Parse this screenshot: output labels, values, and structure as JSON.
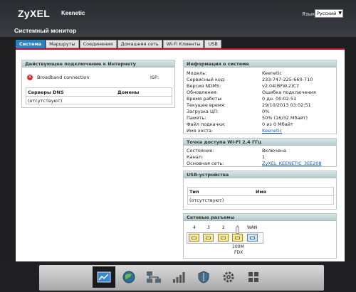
{
  "header": {
    "brand": "ZyXEL",
    "model": "Keenetic",
    "page_title": "Системный монитор",
    "language_label": "Язык:",
    "language_value": "Русский"
  },
  "tabs": [
    {
      "label": "Система",
      "active": true
    },
    {
      "label": "Маршруты"
    },
    {
      "label": "Соединения"
    },
    {
      "label": "Домашняя сеть"
    },
    {
      "label": "Wi-Fi Клиенты"
    },
    {
      "label": "USB"
    }
  ],
  "internet": {
    "title": "Действующее подключение к Интернету",
    "connection_name": "Broadband connection",
    "isp_label": "ISP:",
    "dns_header": "Серверы DNS",
    "domains_header": "Домены",
    "dns_value": "(отсутствуют)"
  },
  "sysinfo": {
    "title": "Информация о системе",
    "rows": [
      {
        "label": "Модель:",
        "value": "Keenetic"
      },
      {
        "label": "Сервисный код:",
        "value": "233-747-225-660-710"
      },
      {
        "label": "Версия NDMS:",
        "value": "v2.04(BFW.2)C7"
      },
      {
        "label": "Обновления:",
        "value": "Ошибка подключения"
      },
      {
        "label": "Время работы:",
        "value": "0 дн. 00:02:51"
      },
      {
        "label": "Текущее время:",
        "value": "29/10/2013 03:02:51"
      },
      {
        "label": "Загрузка ЦП:",
        "value": "0%"
      },
      {
        "label": "Память:",
        "value": "50% (16/32 Мбайт)"
      },
      {
        "label": "Файл подкачки:",
        "value": "0 из 0 Мбайт"
      },
      {
        "label": "Имя хоста:",
        "value": "Keenetic"
      }
    ]
  },
  "wifi": {
    "title": "Точка доступа Wi-Fi 2,4 ГГц",
    "rows": [
      {
        "label": "Состояние:",
        "value": "Включена"
      },
      {
        "label": "Канал:",
        "value": "1"
      },
      {
        "label": "Основная сеть:",
        "value": "ZyXEL_KEENETIC_3EE208"
      }
    ]
  },
  "usb": {
    "title": "USB-устройства",
    "type_header": "Тип",
    "name_header": "Имя",
    "value": "(отсутствуют)"
  },
  "ports": {
    "title": "Сетевые разъемы",
    "labels": [
      "4",
      "3",
      "2",
      "1",
      "WAN"
    ],
    "port1_speed": "100M",
    "port1_duplex": "FDX"
  },
  "dock": {
    "items": [
      "monitor-icon",
      "globe-icon",
      "network-icon",
      "signal-icon",
      "shield-icon",
      "gear-icon",
      "apps-icon"
    ],
    "active_index": 0
  }
}
